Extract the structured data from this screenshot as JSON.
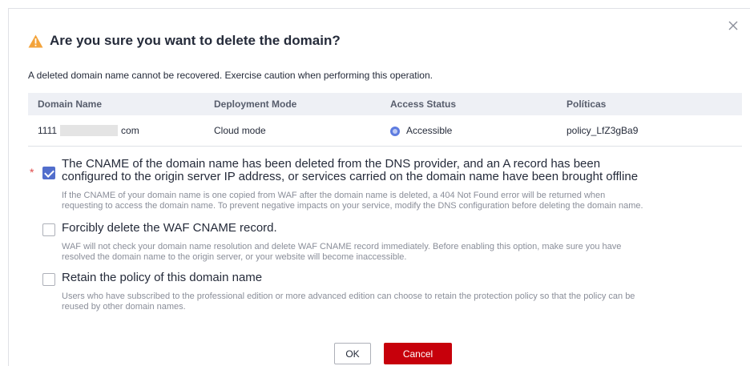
{
  "dialog": {
    "title": "Are you sure you want to delete the domain?",
    "description": "A deleted domain name cannot be recovered. Exercise caution when performing this operation.",
    "close_icon": "close-icon",
    "warning_icon": "warning-icon",
    "warning_color": "#f3a33a"
  },
  "table": {
    "headers": [
      "Domain Name",
      "Deployment Mode",
      "Access Status",
      "Políticas"
    ],
    "rows": [
      {
        "domain_prefix": "1111",
        "domain_suffix": "com",
        "deployment_mode": "Cloud mode",
        "access_status": "Accessible",
        "policy": "policy_LfZ3gBa9"
      }
    ]
  },
  "options": [
    {
      "required_mark": "*",
      "checked": true,
      "label_line1": "The CNAME of the domain name has been deleted from the DNS provider, and an A record has been",
      "label_line2": "configured to the origin server IP address, or services carried on the domain name have been brought offline",
      "help_line1": "If the CNAME of your domain name is one copied from WAF after the domain name is deleted, a 404 Not Found error will be returned when",
      "help_line2": "requesting to access the domain name. To prevent negative impacts on your service, modify the DNS configuration before deleting the domain name."
    },
    {
      "checked": false,
      "label_line1": "Forcibly delete the WAF CNAME record.",
      "help_line1": "WAF will not check your domain name resolution and delete WAF CNAME record immediately. Before enabling this option, make sure you have",
      "help_line2": "resolved the domain name to the origin server, or your website will become inaccessible."
    },
    {
      "checked": false,
      "label_line1": "Retain the policy of this domain name",
      "help_line1": "Users who have subscribed to the professional edition or more advanced edition can choose to retain the protection policy so that the policy can be",
      "help_line2": "reused by other domain names."
    }
  ],
  "buttons": {
    "ok": "OK",
    "cancel": "Cancel",
    "cancel_color": "#c7000b"
  }
}
